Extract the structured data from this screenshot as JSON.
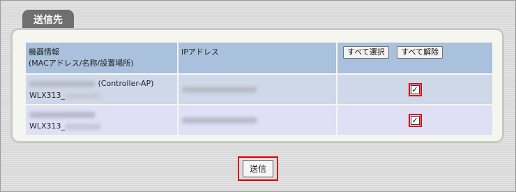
{
  "section": {
    "title": "送信先"
  },
  "table": {
    "headers": {
      "device_info_line1": "機器情報",
      "device_info_line2": "(MACアドレス/名称/設置場所)",
      "ip_address": "IPアドレス"
    },
    "buttons": {
      "select_all": "すべて選択",
      "deselect_all": "すべて解除"
    },
    "rows": [
      {
        "role_suffix": "(Controller-AP)",
        "model_prefix": "WLX313_",
        "checked": true,
        "check_glyph": "✓"
      },
      {
        "role_suffix": "",
        "model_prefix": "WLX313_",
        "checked": true,
        "check_glyph": "✓"
      }
    ]
  },
  "actions": {
    "send_label": "送信"
  },
  "colors": {
    "header_bg": "#a9c1dc",
    "highlight_border": "#e00000",
    "tab_bg": "#6f6f6f"
  }
}
